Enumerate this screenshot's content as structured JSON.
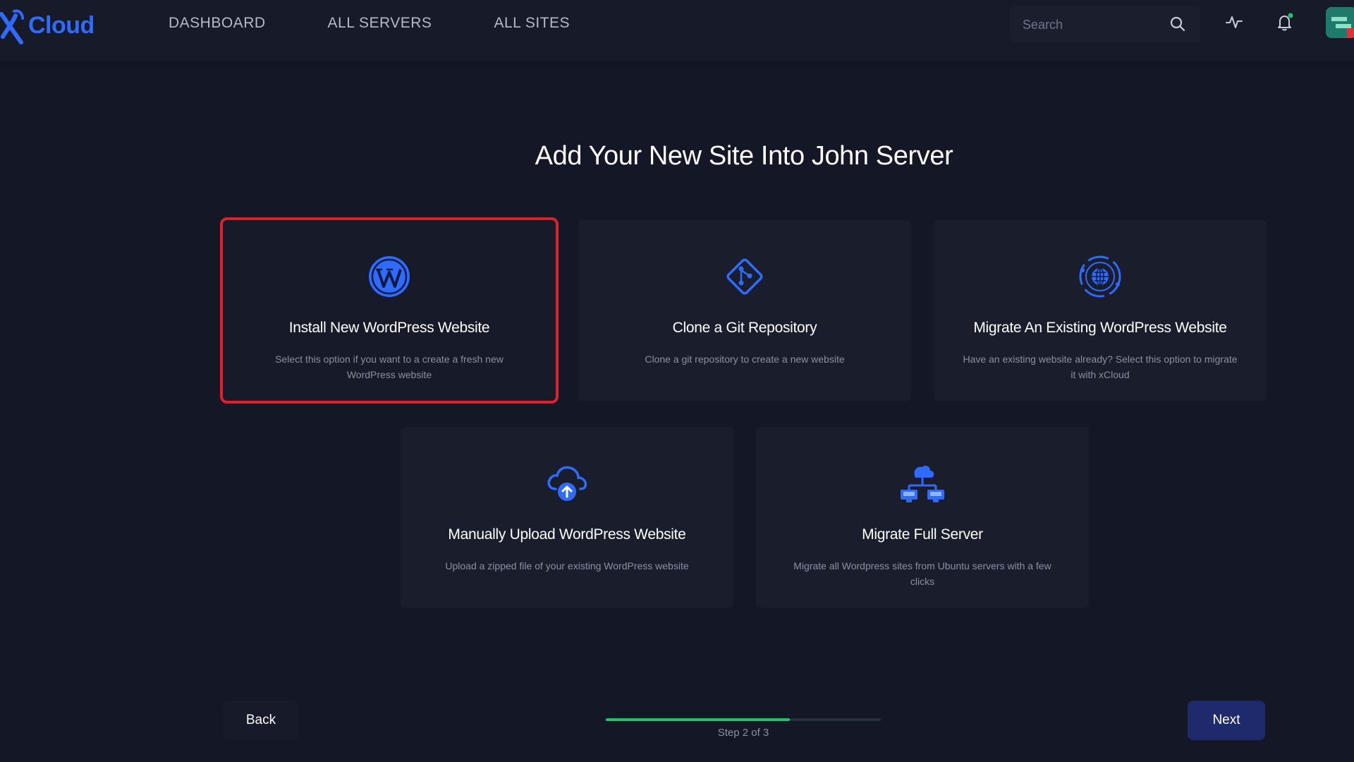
{
  "brand": {
    "name": "Cloud",
    "accent": "#2f6bff"
  },
  "nav": {
    "items": [
      {
        "label": "DASHBOARD"
      },
      {
        "label": "ALL SERVERS"
      },
      {
        "label": "ALL SITES"
      }
    ]
  },
  "search": {
    "placeholder": "Search",
    "value": ""
  },
  "header_icons": [
    "search-icon",
    "activity-icon",
    "bell-icon",
    "avatar"
  ],
  "page": {
    "title": "Add Your New Site Into John Server"
  },
  "options": [
    {
      "title": "Install New WordPress Website",
      "description": "Select this option if you want to a create a fresh new WordPress website",
      "icon": "wordpress-icon",
      "selected": true
    },
    {
      "title": "Clone a Git Repository",
      "description": "Clone a git repository to create a new website",
      "icon": "git-icon",
      "selected": false
    },
    {
      "title": "Migrate An Existing WordPress Website",
      "description": "Have an existing website already? Select this option to migrate it with xCloud",
      "icon": "globe-migrate-icon",
      "selected": false
    },
    {
      "title": "Manually Upload WordPress Website",
      "description": "Upload a zipped file of your existing WordPress website",
      "icon": "cloud-upload-icon",
      "selected": false
    },
    {
      "title": "Migrate Full Server",
      "description": "Migrate all Wordpress sites from Ubuntu servers with a few clicks",
      "icon": "server-network-icon",
      "selected": false
    }
  ],
  "footer": {
    "back_label": "Back",
    "next_label": "Next",
    "step_label": "Step 2 of 3",
    "progress": 0.67
  },
  "colors": {
    "background": "#141725",
    "card": "#1a1d2c",
    "selected_outline": "#e0202a",
    "progress": "#17c964",
    "next_button": "#1e2a6b"
  }
}
